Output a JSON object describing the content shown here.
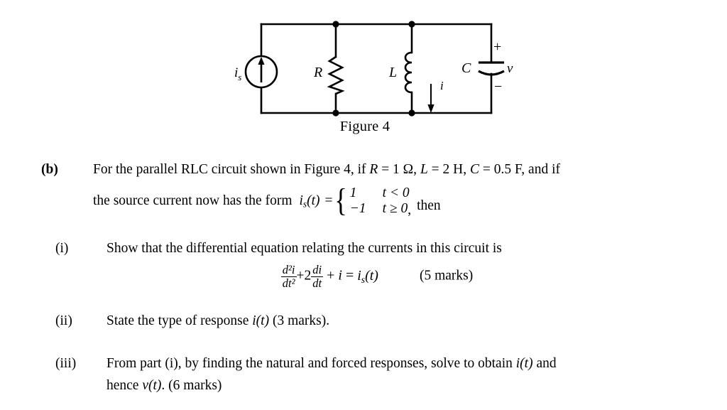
{
  "figure": {
    "caption": "Figure 4",
    "components": {
      "source_label_main": "i",
      "source_label_sub": "s",
      "resistor_label": "R",
      "inductor_label": "L",
      "capacitor_label": "C",
      "voltage_label": "v",
      "current_label": "i",
      "polarity_plus": "+",
      "polarity_minus": "−"
    }
  },
  "part_b": {
    "marker": "(b)",
    "line1": "For the parallel RLC circuit shown in Figure 4, if R = 1 Ω, L = 2 H, C = 0.5 F, and if",
    "line1_segments": {
      "text_a": "For the parallel RLC circuit shown in Figure 4, if ",
      "var_r": "R",
      "val_r": " = 1 Ω, ",
      "var_l": "L",
      "val_l": " = 2 H, ",
      "var_c": "C",
      "val_c": " = 0.5 F, and if"
    },
    "line2_prefix": "the source current now has the form",
    "source_func_main": "i",
    "source_func_sub": "s",
    "source_func_arg": "(t)",
    "equals": "=",
    "piecewise": [
      {
        "value": "1",
        "condition": "t < 0"
      },
      {
        "value": "−1",
        "condition": "t ≥ 0"
      }
    ],
    "piecewise_comma": ",",
    "then": "then"
  },
  "part_i": {
    "marker": "(i)",
    "text": "Show that the differential equation relating the currents in this circuit is",
    "equation": {
      "frac1_num": "d²i",
      "frac1_den": "dt²",
      "plus_coeff": "+2",
      "frac2_num": "di",
      "frac2_den": "dt",
      "tail_plus": "+",
      "tail_i": "i",
      "tail_equals": "=",
      "tail_is_main": "i",
      "tail_is_sub": "s",
      "tail_is_arg": "(t)"
    },
    "marks": "(5 marks)"
  },
  "part_ii": {
    "marker": "(ii)",
    "text_a": "State the type of response ",
    "var_i": "i",
    "var_t": "(t)",
    "text_b": "  (3 marks)."
  },
  "part_iii": {
    "marker": "(iii)",
    "line1_a": "From part (i), by finding the natural and forced responses, solve to obtain ",
    "line1_i": "i",
    "line1_t": "(t)",
    "line1_b": " and",
    "line2_a": "hence ",
    "line2_v": "v",
    "line2_t": "(t)",
    "line2_b": ". (6 marks)"
  },
  "colors": {
    "ink": "#000000",
    "paper": "#ffffff"
  }
}
